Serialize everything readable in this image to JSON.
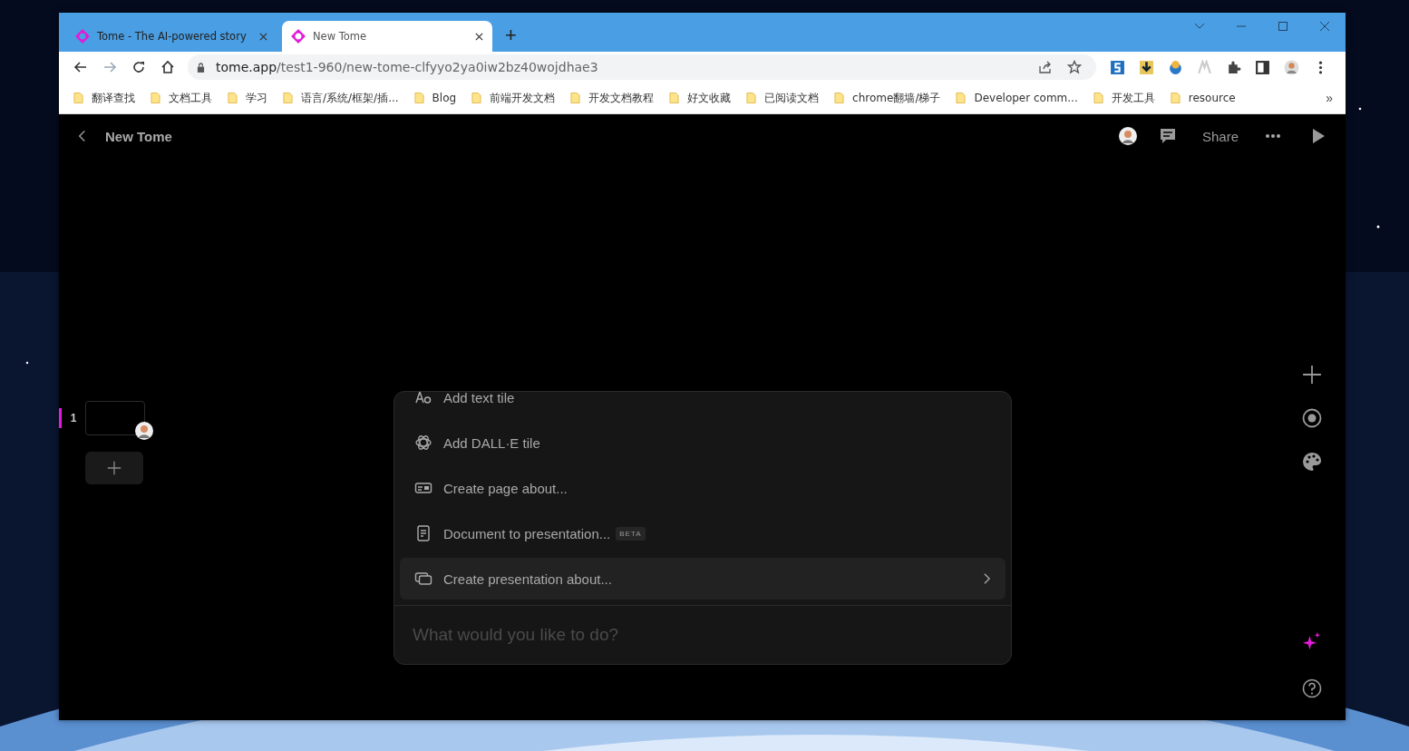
{
  "browser": {
    "tabs": [
      {
        "title": "Tome - The AI-powered story",
        "selected": false
      },
      {
        "title": "New Tome",
        "selected": true
      }
    ],
    "new_tab": "+",
    "address": {
      "host": "tome.app",
      "path": "/test1-960/new-tome-clfyyo2ya0iw2bz40wojdhae3"
    },
    "bookmarks": [
      "翻译查找",
      "文档工具",
      "学习",
      "语言/系统/框架/插...",
      "Blog",
      "前端开发文档",
      "开发文档教程",
      "好文收藏",
      "已阅读文档",
      "chrome翻墙/梯子",
      "Developer comm...",
      "开发工具",
      "resource"
    ],
    "bookmarks_overflow": "»"
  },
  "app": {
    "title": "New Tome",
    "share": "Share",
    "pages": [
      {
        "number": "1",
        "selected": true
      }
    ],
    "command_menu": {
      "items": [
        {
          "kind": "text",
          "label": "Add text tile",
          "selected": false
        },
        {
          "kind": "dalle",
          "label": "Add DALL·E tile",
          "selected": false
        },
        {
          "kind": "page",
          "label": "Create page about...",
          "selected": false
        },
        {
          "kind": "document",
          "label": "Document to presentation...",
          "badge": "BETA",
          "selected": false
        },
        {
          "kind": "presentation",
          "label": "Create presentation about...",
          "selected": true
        }
      ],
      "placeholder": "What would you like to do?"
    }
  }
}
